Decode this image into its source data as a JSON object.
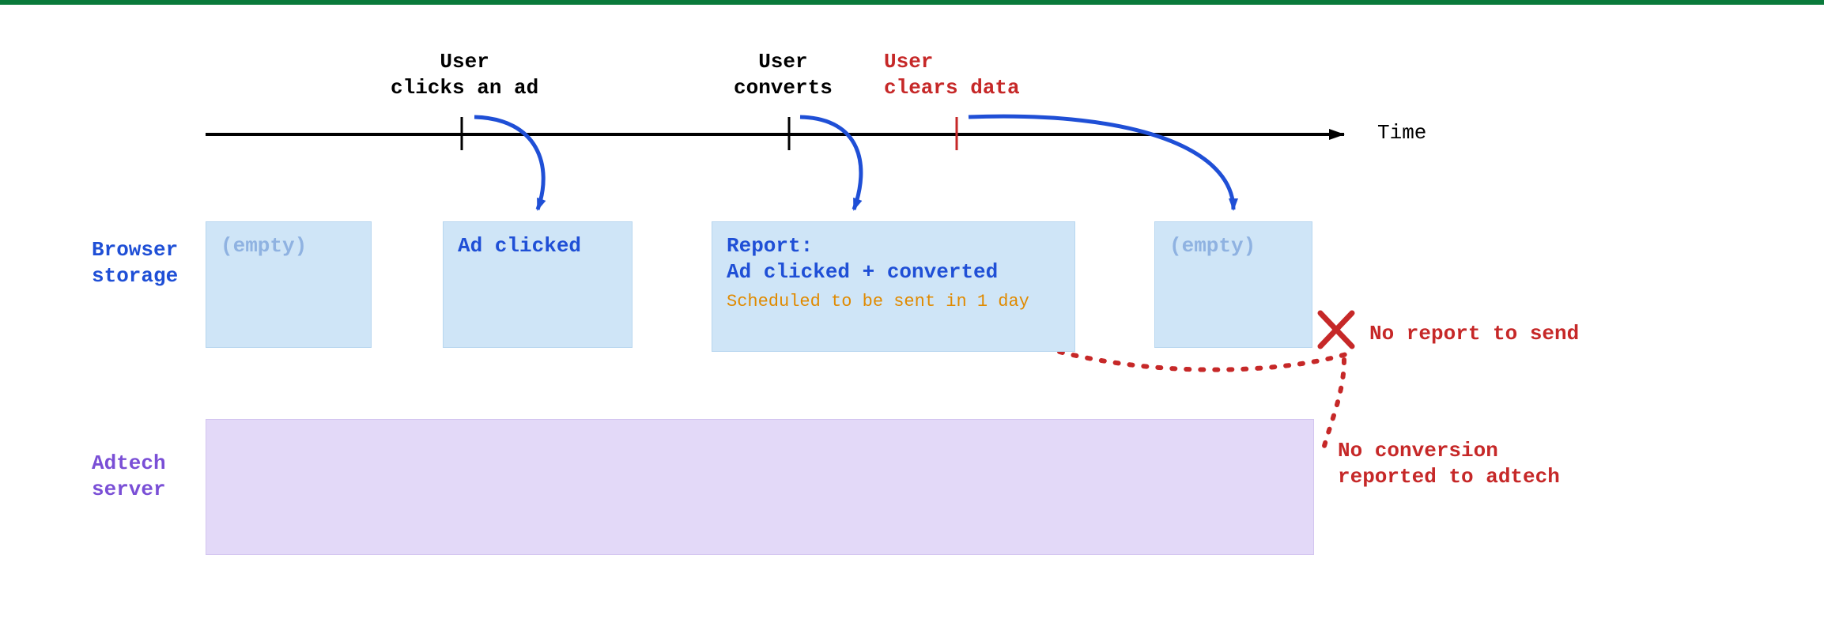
{
  "timeline": {
    "axis_label": "Time",
    "events": {
      "click_ad": "User\nclicks an ad",
      "converts": "User\nconverts",
      "clears": "User\nclears data"
    }
  },
  "rows": {
    "browser_storage": {
      "label": "Browser\nstorage",
      "boxes": {
        "empty1": "(empty)",
        "ad_clicked": "Ad clicked",
        "report_title": "Report:",
        "report_body": "Ad clicked + converted",
        "report_sched": "Scheduled to be sent in 1 day",
        "empty2": "(empty)"
      }
    },
    "adtech_server": {
      "label": "Adtech\nserver"
    }
  },
  "errors": {
    "no_report": "No report to send",
    "no_conversion": "No conversion\nreported to adtech"
  }
}
